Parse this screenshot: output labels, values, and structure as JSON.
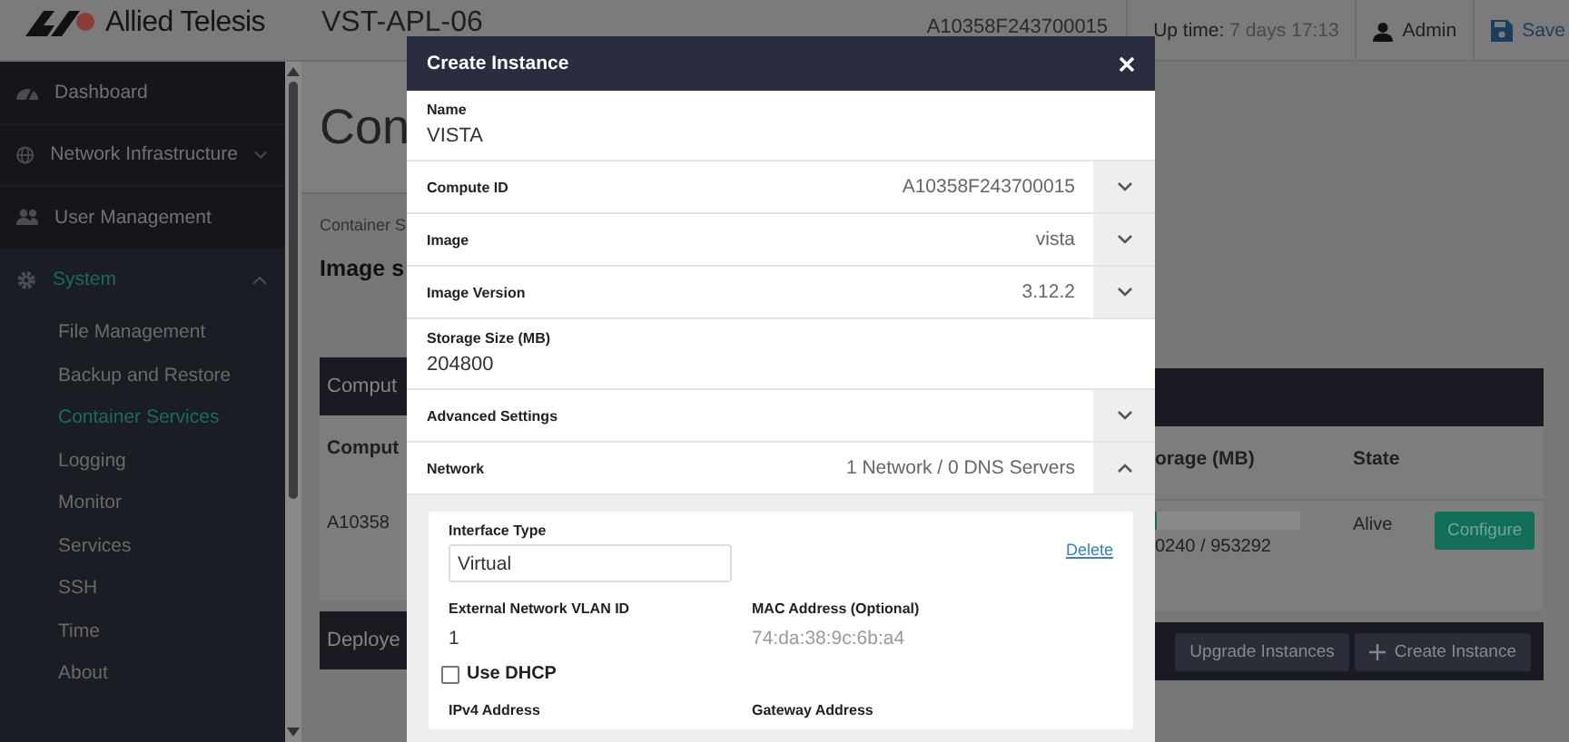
{
  "header": {
    "brand": "Allied Telesis",
    "device": "VST-APL-06",
    "serial": "A10358F243700015",
    "uptime_label": "Up time:",
    "uptime_value": "7 days 17:13",
    "user": "Admin",
    "save": "Save"
  },
  "sidebar": {
    "items": [
      {
        "label": "Dashboard",
        "kind": "link",
        "selected": false
      },
      {
        "label": "Network Infrastructure",
        "kind": "group",
        "selected": false,
        "expanded": false
      },
      {
        "label": "User Management",
        "kind": "link",
        "selected": false
      },
      {
        "label": "System",
        "kind": "group",
        "selected": true,
        "expanded": true,
        "children": [
          {
            "label": "File Management",
            "selected": false
          },
          {
            "label": "Backup and Restore",
            "selected": false
          },
          {
            "label": "Container Services",
            "selected": true
          },
          {
            "label": "Logging",
            "selected": false
          },
          {
            "label": "Monitor",
            "selected": false
          },
          {
            "label": "Services",
            "selected": false
          },
          {
            "label": "SSH",
            "selected": false
          },
          {
            "label": "Time",
            "selected": false
          },
          {
            "label": "About",
            "selected": false
          }
        ]
      }
    ]
  },
  "main": {
    "page_title": "Con",
    "breadcrumb": "Container S",
    "section_title": "Image s",
    "compute_panel": {
      "title": "Comput",
      "columns": [
        "Comput",
        "orage (MB)",
        "State"
      ],
      "row": {
        "id": "A10358",
        "level": 0.01,
        "storage": "0240 / 953292",
        "state": "Alive",
        "action": "Configure"
      }
    },
    "deployed_panel": {
      "title": "Deploye",
      "buttons": [
        {
          "label": "Upgrade Instances",
          "kind": "plain"
        },
        {
          "label": "Create Instance",
          "kind": "add"
        }
      ]
    }
  },
  "modal": {
    "title": "Create Instance",
    "fields": [
      {
        "kind": "input",
        "label": "Name",
        "value": "VISTA"
      },
      {
        "kind": "select",
        "label": "Compute ID",
        "value": "A10358F243700015",
        "expanded": false
      },
      {
        "kind": "select",
        "label": "Image",
        "value": "vista",
        "expanded": false
      },
      {
        "kind": "select",
        "label": "Image Version",
        "value": "3.12.2",
        "expanded": false
      },
      {
        "kind": "input",
        "label": "Storage Size (MB)",
        "value": "204800"
      },
      {
        "kind": "select",
        "label": "Advanced Settings",
        "expanded": false
      },
      {
        "kind": "select",
        "label": "Network",
        "value": "1 Network / 0 DNS Servers",
        "expanded": true
      }
    ],
    "network": {
      "interface_type_label": "Interface Type",
      "interface_type": "Virtual",
      "delete": "Delete",
      "vlan_label": "External Network VLAN ID",
      "vlan": "1",
      "mac_label": "MAC Address (Optional)",
      "mac_placeholder": "74:da:38:9c:6b:a4",
      "dhcp_label": "Use DHCP",
      "dhcp_checked": false,
      "ipv4_label": "IPv4 Address",
      "gateway_label": "Gateway Address"
    }
  }
}
